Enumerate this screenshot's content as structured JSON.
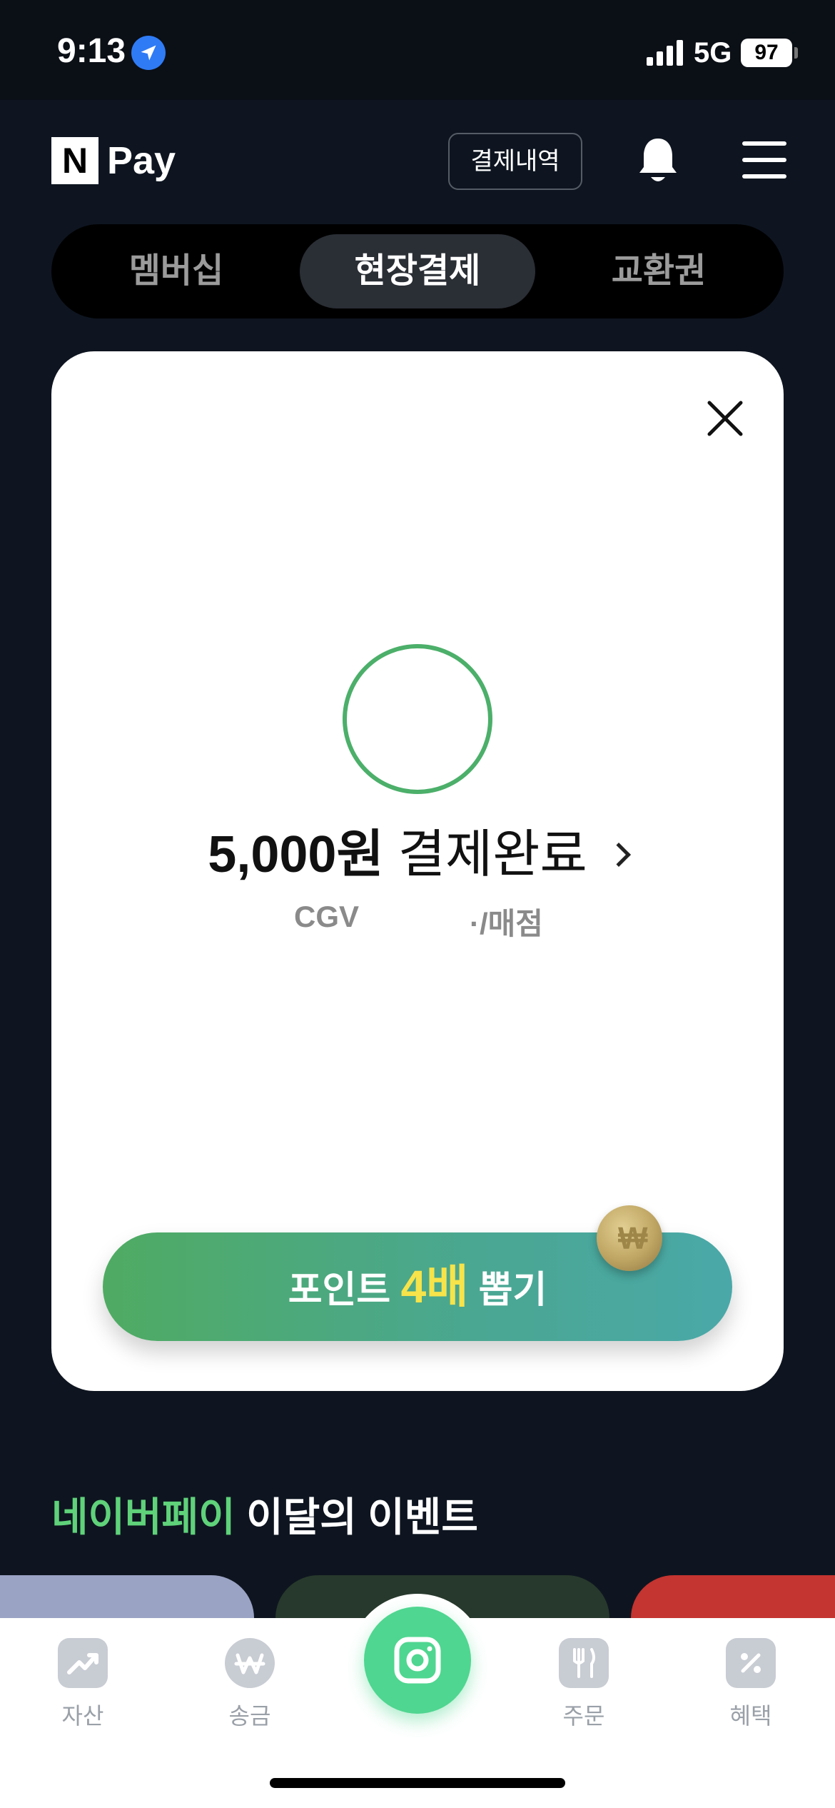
{
  "status_bar": {
    "time": "9:13",
    "network": "5G",
    "battery": "97"
  },
  "header": {
    "logo_letter": "N",
    "logo_text": "Pay",
    "history_label": "결제내역"
  },
  "tabs": [
    {
      "label": "멤버십",
      "active": false
    },
    {
      "label": "현장결제",
      "active": true
    },
    {
      "label": "교환권",
      "active": false
    }
  ],
  "payment": {
    "amount": "5,000원",
    "status": "결제완료",
    "merchant_name": "CGV",
    "merchant_branch": "·/매점"
  },
  "promo": {
    "prefix": "포인트 ",
    "highlight": "4배",
    "suffix": " 뽑기",
    "coin_symbol": "₩"
  },
  "events": {
    "title_green": "네이버페이",
    "title_rest": " 이달의 이벤트"
  },
  "bottom_nav": [
    {
      "label": "자산",
      "icon": "chart-up-icon"
    },
    {
      "label": "송금",
      "icon": "won-icon"
    },
    {
      "label": "주문",
      "icon": "fork-knife-icon"
    },
    {
      "label": "혜택",
      "icon": "percent-coupon-icon"
    }
  ],
  "colors": {
    "accent_green": "#5fd27a",
    "promo_highlight": "#f7e34a",
    "success_ring": "#4caf6a",
    "scan_button": "#4fd690"
  }
}
